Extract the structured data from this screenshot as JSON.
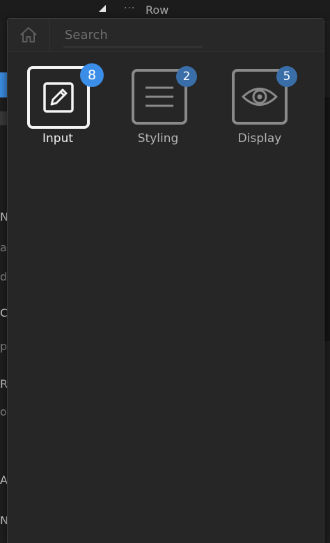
{
  "background": {
    "breadcrumb_dots": "···",
    "breadcrumb_label": "Row",
    "fragments": [
      "N",
      "ar",
      "d",
      "C",
      "p",
      "R",
      "o",
      "A",
      "N"
    ]
  },
  "popup": {
    "home_icon": "home-icon",
    "search": {
      "placeholder": "Search",
      "value": ""
    },
    "categories": [
      {
        "label": "Input",
        "count": "8",
        "icon": "pencil-edit-icon",
        "active": true
      },
      {
        "label": "Styling",
        "count": "2",
        "icon": "align-lines-icon",
        "active": false
      },
      {
        "label": "Display",
        "count": "5",
        "icon": "eye-icon",
        "active": false
      }
    ]
  },
  "colors": {
    "accent": "#3b8ee8",
    "badge_inactive": "#3a6ea8",
    "panel_bg": "#262626",
    "active_border": "#f4f4f4",
    "inactive_border": "#8a8a8a"
  }
}
